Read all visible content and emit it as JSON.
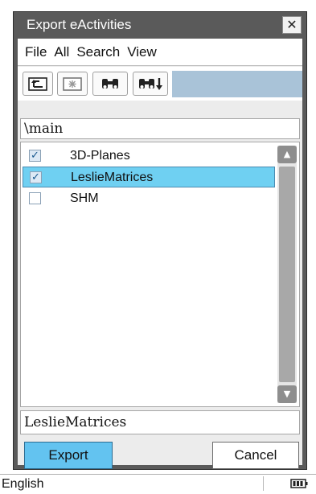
{
  "dialog": {
    "title": "Export eActivities",
    "close_glyph": "✕"
  },
  "menu": {
    "items": [
      "File",
      "All",
      "Search",
      "View"
    ]
  },
  "toolbar": {
    "buttons": [
      "up-folder-icon",
      "new-folder-icon",
      "binoculars-icon",
      "search-next-icon"
    ]
  },
  "path": "\\main",
  "files": [
    {
      "name": "3D-Planes",
      "checked": true,
      "selected": false
    },
    {
      "name": "LeslieMatrices",
      "checked": true,
      "selected": true
    },
    {
      "name": "SHM",
      "checked": false,
      "selected": false
    }
  ],
  "scrollbar": {
    "up_glyph": "▲",
    "down_glyph": "▼"
  },
  "filename": "LeslieMatrices",
  "buttons": {
    "export": "Export",
    "cancel": "Cancel"
  },
  "status": {
    "language": "English",
    "battery_icon": "battery-icon"
  },
  "colors": {
    "selection": "#6fd0f2",
    "primary_button": "#63c3f0",
    "toolbar_accent": "#a9c3d8",
    "title_bar": "#5a5a5a"
  }
}
